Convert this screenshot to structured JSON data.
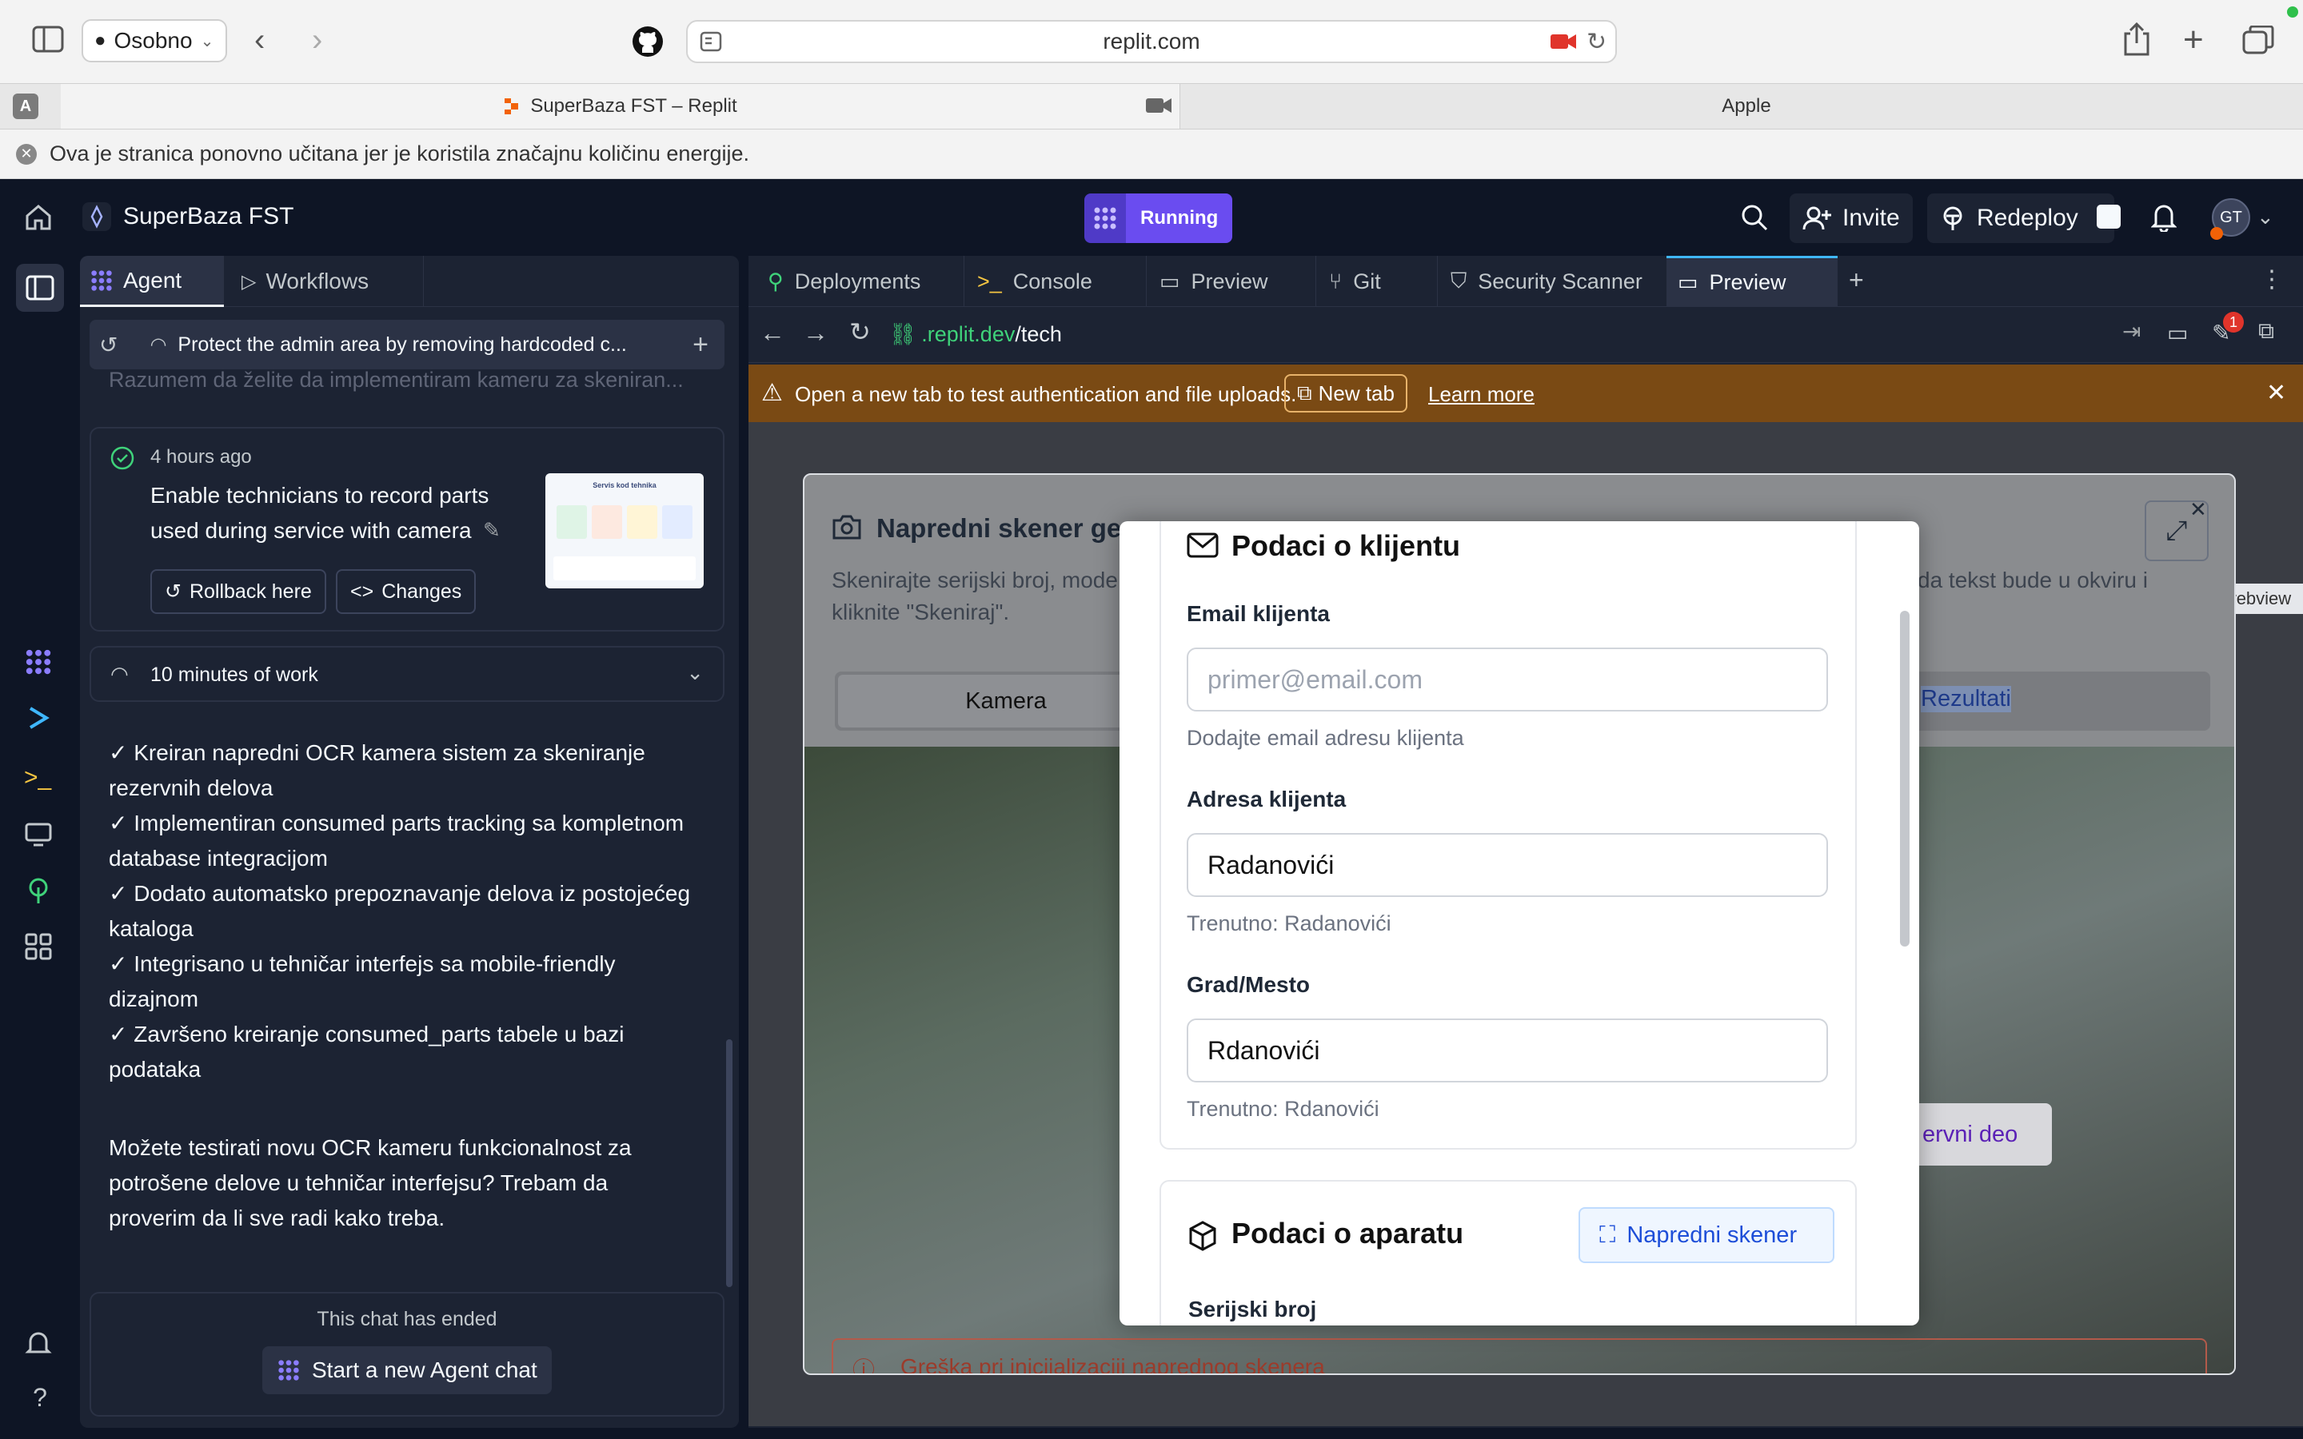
{
  "browser": {
    "profile": "Osobno",
    "url": "replit.com",
    "tabs": [
      {
        "label": "SuperBaza FST – Replit"
      },
      {
        "label": "Apple"
      }
    ],
    "tab_badge": "A",
    "energy_notice": "Ova je stranica ponovno učitana jer je koristila značajnu količinu energije."
  },
  "header": {
    "project": "SuperBaza FST",
    "status": "Running",
    "invite": "Invite",
    "redeploy": "Redeploy",
    "avatar": "GT"
  },
  "agent": {
    "tabs": [
      "Agent",
      "Workflows"
    ],
    "thread_title": "Protect the admin area by removing hardcoded c...",
    "faded_text": "Razumem da želite da implementiram kameru za skeniran...",
    "checkpoint": {
      "time": "4 hours ago",
      "title_lines": [
        "Enable technicians to record parts",
        "used during service with camera"
      ],
      "rollback": "Rollback here",
      "changes": "Changes",
      "thumb_title": "Servis kod tehnika"
    },
    "work": "10 minutes of work",
    "message_lines": [
      "✓ Kreiran napredni OCR kamera sistem za skeniranje",
      "rezervnih delova",
      "✓ Implementiran consumed parts tracking sa kompletnom",
      "database integracijom",
      "✓ Dodato automatsko prepoznavanje delova iz postojećeg",
      "kataloga",
      "✓ Integrisano u tehničar interfejs sa mobile-friendly",
      "dizajnom",
      "✓ Završeno kreiranje consumed_parts tabele u bazi",
      "podataka"
    ],
    "question_lines": [
      "Možete testirati novu OCR kameru funkcionalnost za",
      "potrošene delove u tehničar interfejsu? Trebam da",
      "proverim da li sve radi kako treba."
    ],
    "ended": "This chat has ended",
    "new_chat": "Start a new Agent chat"
  },
  "right": {
    "tabs": [
      "Deployments",
      "Console",
      "Preview",
      "Git",
      "Security Scanner",
      "Preview"
    ],
    "address": {
      "host": ".replit.dev",
      "path": "/tech"
    },
    "badge": "1",
    "warning": "Open a new tab to test authentication and file uploads.",
    "new_tab": "New tab",
    "learn_more": "Learn more",
    "webview_tag": "webview"
  },
  "scanner": {
    "title": "Napredni skener ge",
    "desc_left": "Skenirajte serijski broj, mode",
    "desc_left2": "kliknite \"Skeniraj\".",
    "desc_right": "da tekst bude u okviru i",
    "tab_camera": "Kamera",
    "tab_results": "Rezultati",
    "partial_button": "ervni deo",
    "error": "Greška pri inicijalizaciji naprednog skenera"
  },
  "form": {
    "section_client": "Podaci o klijentu",
    "email_label": "Email klijenta",
    "email_placeholder": "primer@email.com",
    "email_hint": "Dodajte email adresu klijenta",
    "address_label": "Adresa klijenta",
    "address_value": "Radanovići",
    "address_hint": "Trenutno: Radanovići",
    "city_label": "Grad/Mesto",
    "city_value": "Rdanovići",
    "city_hint": "Trenutno: Rdanovići",
    "section_device": "Podaci o aparatu",
    "scanner_button": "Napredni skener",
    "serial_label": "Serijski broj"
  }
}
